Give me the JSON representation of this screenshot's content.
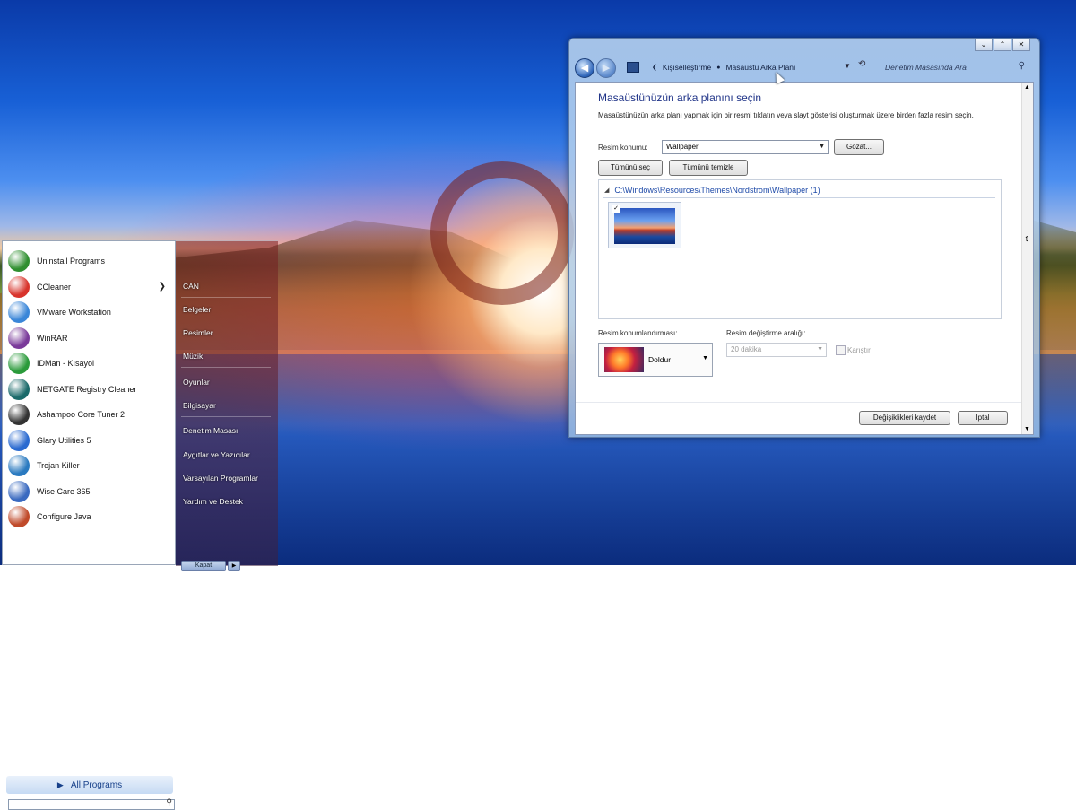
{
  "start_menu": {
    "programs": [
      {
        "label": "Uninstall Programs",
        "icon": "uninstall-icon",
        "color": "#2f8f2f"
      },
      {
        "label": "CCleaner",
        "icon": "ccleaner-icon",
        "color": "#d8342c",
        "has_submenu": true
      },
      {
        "label": "VMware Workstation",
        "icon": "vmware-icon",
        "color": "#3a86d8"
      },
      {
        "label": "WinRAR",
        "icon": "winrar-icon",
        "color": "#7a3a9a"
      },
      {
        "label": "IDMan - Kısayol",
        "icon": "idm-icon",
        "color": "#2a9a3a"
      },
      {
        "label": "NETGATE Registry Cleaner",
        "icon": "netgate-icon",
        "color": "#1a6a6a"
      },
      {
        "label": "Ashampoo Core Tuner 2",
        "icon": "ashampoo-icon",
        "color": "#333333"
      },
      {
        "label": "Glary Utilities 5",
        "icon": "glary-icon",
        "color": "#2a6ad0"
      },
      {
        "label": "Trojan Killer",
        "icon": "trojan-killer-icon",
        "color": "#2a7ac0"
      },
      {
        "label": "Wise Care 365",
        "icon": "wise-care-icon",
        "color": "#3a6ac0"
      },
      {
        "label": "Configure Java",
        "icon": "java-icon",
        "color": "#c04a2a"
      }
    ],
    "all_programs": "All Programs",
    "right_links": [
      "CAN",
      "Belgeler",
      "Resimler",
      "Müzik",
      "Oyunlar",
      "Bilgisayar",
      "Denetim Masası",
      "Aygıtlar ve Yazıcılar",
      "Varsayılan Programlar",
      "Yardım ve Destek"
    ],
    "shutdown_label": "Kapat"
  },
  "window": {
    "breadcrumb": [
      "Kişiselleştirme",
      "Masaüstü Arka Planı"
    ],
    "search_placeholder": "Denetim Masasında Ara",
    "title": "Masaüstünüzün arka planını seçin",
    "description": "Masaüstünüzün arka planı yapmak için bir resmi tıklatın veya slayt gösterisi oluşturmak üzere birden fazla resim seçin.",
    "location_label": "Resim konumu:",
    "location_value": "Wallpaper",
    "browse_button": "Gözat...",
    "select_all_button": "Tümünü seç",
    "clear_all_button": "Tümünü temizle",
    "folder_path": "C:\\Windows\\Resources\\Themes\\Nordstrom\\Wallpaper (1)",
    "positioning_label": "Resim konumlandırması:",
    "positioning_value": "Doldur",
    "interval_label": "Resim değiştirme aralığı:",
    "interval_value": "20 dakika",
    "shuffle_label": "Karıştır",
    "save_button": "Değişiklikleri kaydet",
    "cancel_button": "İptal"
  }
}
